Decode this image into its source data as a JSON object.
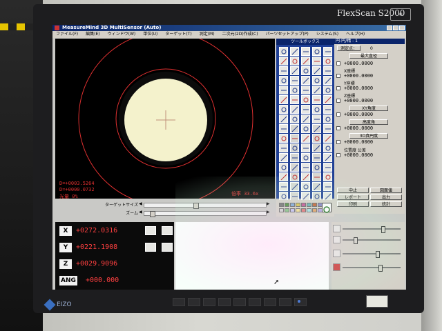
{
  "monitor": {
    "brand": "FlexScan S2000",
    "logo_text": "EIZO",
    "sticker_text": ""
  },
  "window": {
    "title": "MeasureMind 3D MultiSensor (Auto)"
  },
  "menu": [
    "ファイル(F)",
    "編集(E)",
    "ウィンドウ(W)",
    "単位(U)",
    "ターゲット(T)",
    "測定(M)",
    "二次元(2D)作成(C)",
    "パーツセットアップ(P)",
    "システム(S)",
    "ヘルプ(H)"
  ],
  "camera": {
    "readout_line1": "D=+0003.5264",
    "readout_line2": "D=+0000.0732",
    "readout_line3": "光量   0%",
    "zoom_label": "倍率 33.6x"
  },
  "sliders": {
    "target_size_label": "ターゲットサイズ",
    "zoom_label": "ズーム",
    "target_size_level": 0.42,
    "zoom_level": 0.05
  },
  "toolbox": {
    "title": "ツールボックス"
  },
  "panel": {
    "title": "円-円/楕 - 1",
    "count_button": "測定点：",
    "count_value": "0",
    "feature_button": "最大直径",
    "rows": [
      {
        "label": "",
        "value": "+0000.0000"
      },
      {
        "label": "X座標",
        "value": "+0000.0000"
      },
      {
        "label": "Y座標",
        "value": "+0000.0000"
      },
      {
        "label": "Z座標",
        "value": "+0000.0000"
      },
      {
        "label": "XY角度",
        "value": "+0000.0000"
      },
      {
        "label": "高度角",
        "value": "+0000.0000"
      },
      {
        "label": "3D真円度",
        "value": "+0000.0000"
      },
      {
        "label": "位置度 公差",
        "value": "+0000.0000"
      }
    ],
    "buttons": [
      "中止",
      "図面値",
      "レポート",
      "出力",
      "印刷",
      "統計"
    ]
  },
  "dro": {
    "x_label": "X",
    "x_value": "+0272.0316",
    "y_label": "Y",
    "y_value": "+0221.1908",
    "z_label": "Z",
    "z_value": "+0029.9096",
    "ang_label": "ANG",
    "ang_value": "+000.000"
  },
  "lighting": {
    "levels": [
      0.7,
      0.2,
      0.6,
      0.65
    ]
  },
  "colors": {
    "dro_text": "#ff4040",
    "camera_ring": "#e03030",
    "field_of_view": "#f6f4cf",
    "title_bar": "#0a246a",
    "toolbox_bg": "#1f3f95"
  }
}
